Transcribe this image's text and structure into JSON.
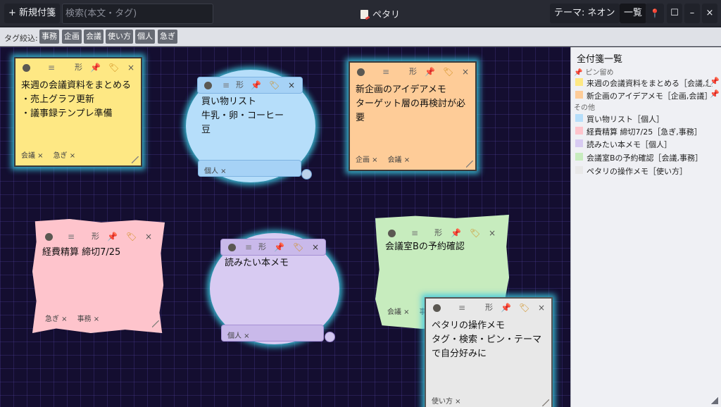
{
  "toolbar": {
    "new_note": "+ 新規付箋",
    "search_placeholder": "検索(本文・タグ)",
    "title": "ペタリ",
    "theme": "テーマ: ネオン",
    "list": "一覧",
    "pin_icon": "📍",
    "maximize_icon": "☐",
    "minimize_icon": "–",
    "close_icon": "×"
  },
  "tagbar": {
    "label": "タグ絞込:",
    "tags": [
      "事務",
      "企画",
      "会議",
      "使い方",
      "個人",
      "急ぎ"
    ]
  },
  "note_controls": {
    "shape": "形",
    "menu": "≡",
    "close": "×",
    "pin": "📌",
    "tag": "🏷"
  },
  "notes": [
    {
      "text": "来週の会議資料をまとめる\n・売上グラフ更新\n・議事録テンプレ準備",
      "tags": [
        "会議 ×",
        "急ぎ ×"
      ],
      "color": "#fee884",
      "pinned": true
    },
    {
      "text": "買い物リスト\n牛乳・卵・コーヒー豆",
      "tags": [
        "個人 ×"
      ],
      "color": "#b6defa",
      "pinned": false
    },
    {
      "text": "新企画のアイデアメモ\nターゲット層の再検討が必要",
      "tags": [
        "企画 ×",
        "会議 ×"
      ],
      "color": "#fecc98",
      "pinned": true
    },
    {
      "text": "経費精算 締切7/25",
      "tags": [
        "急ぎ ×",
        "事務 ×"
      ],
      "color": "#fec4cc",
      "pinned": false
    },
    {
      "text": "読みたい本メモ",
      "tags": [
        "個人 ×"
      ],
      "color": "#d8cbf2",
      "pinned": false
    },
    {
      "text": "会議室Bの予約確認",
      "tags": [
        "会議 ×",
        "事務 ×"
      ],
      "color": "#c7ecbe",
      "pinned": false
    },
    {
      "text": "ペタリの操作メモ\nタグ・検索・ピン・テーマで自分好みに",
      "tags": [
        "使い方 ×"
      ],
      "color": "#e8e8e8",
      "pinned": false
    }
  ],
  "sidebar": {
    "heading": "全付箋一覧",
    "pinned_label": "ピン留め",
    "pinned_icon": "📌",
    "others_label": "その他",
    "pinned": [
      {
        "label": "来週の会議資料をまとめる［会議,急",
        "color": "#fee884"
      },
      {
        "label": "新企画のアイデアメモ［企画,会議］",
        "color": "#fecc98"
      }
    ],
    "others": [
      {
        "label": "買い物リスト［個人］",
        "color": "#b6defa"
      },
      {
        "label": "経費精算 締切7/25［急ぎ,事務］",
        "color": "#fec4cc"
      },
      {
        "label": "読みたい本メモ［個人］",
        "color": "#d8cbf2"
      },
      {
        "label": "会議室Bの予約確認［会議,事務］",
        "color": "#c7ecbe"
      },
      {
        "label": "ペタリの操作メモ［使い方］",
        "color": "#e8e8e8"
      }
    ]
  }
}
